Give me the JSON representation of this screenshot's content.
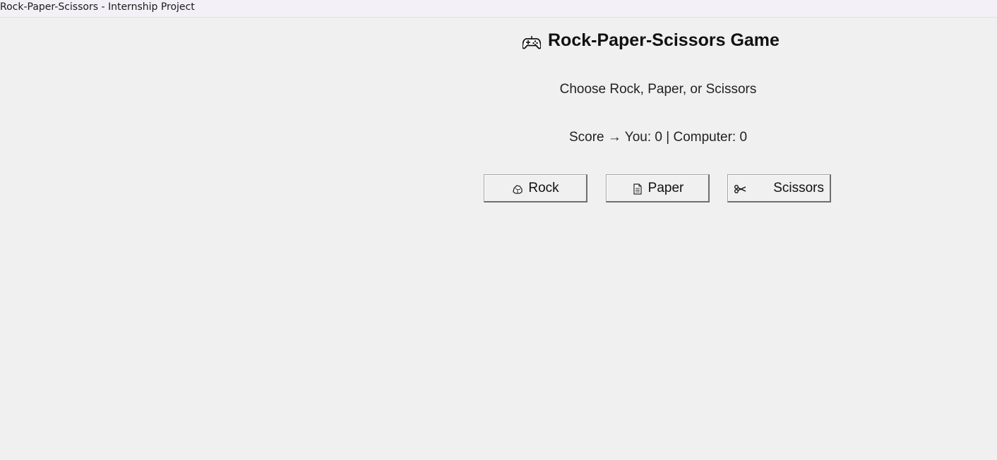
{
  "window": {
    "title": "Rock-Paper-Scissors - Internship Project"
  },
  "game": {
    "title": "Rock-Paper-Scissors Game",
    "title_icon": "gamepad-icon",
    "instruction": "Choose Rock, Paper, or Scissors",
    "score_text": "Score → You: 0 | Computer: 0",
    "score": {
      "you": 0,
      "computer": 0
    }
  },
  "buttons": {
    "rock": {
      "label": "Rock",
      "icon": "rock-icon"
    },
    "paper": {
      "label": "Paper",
      "icon": "page-icon"
    },
    "scissors": {
      "label": "Scissors",
      "icon": "scissors-icon"
    }
  },
  "colors": {
    "background": "#f0f0f0",
    "titlebar": "#f3f0f7",
    "text": "#111111"
  }
}
